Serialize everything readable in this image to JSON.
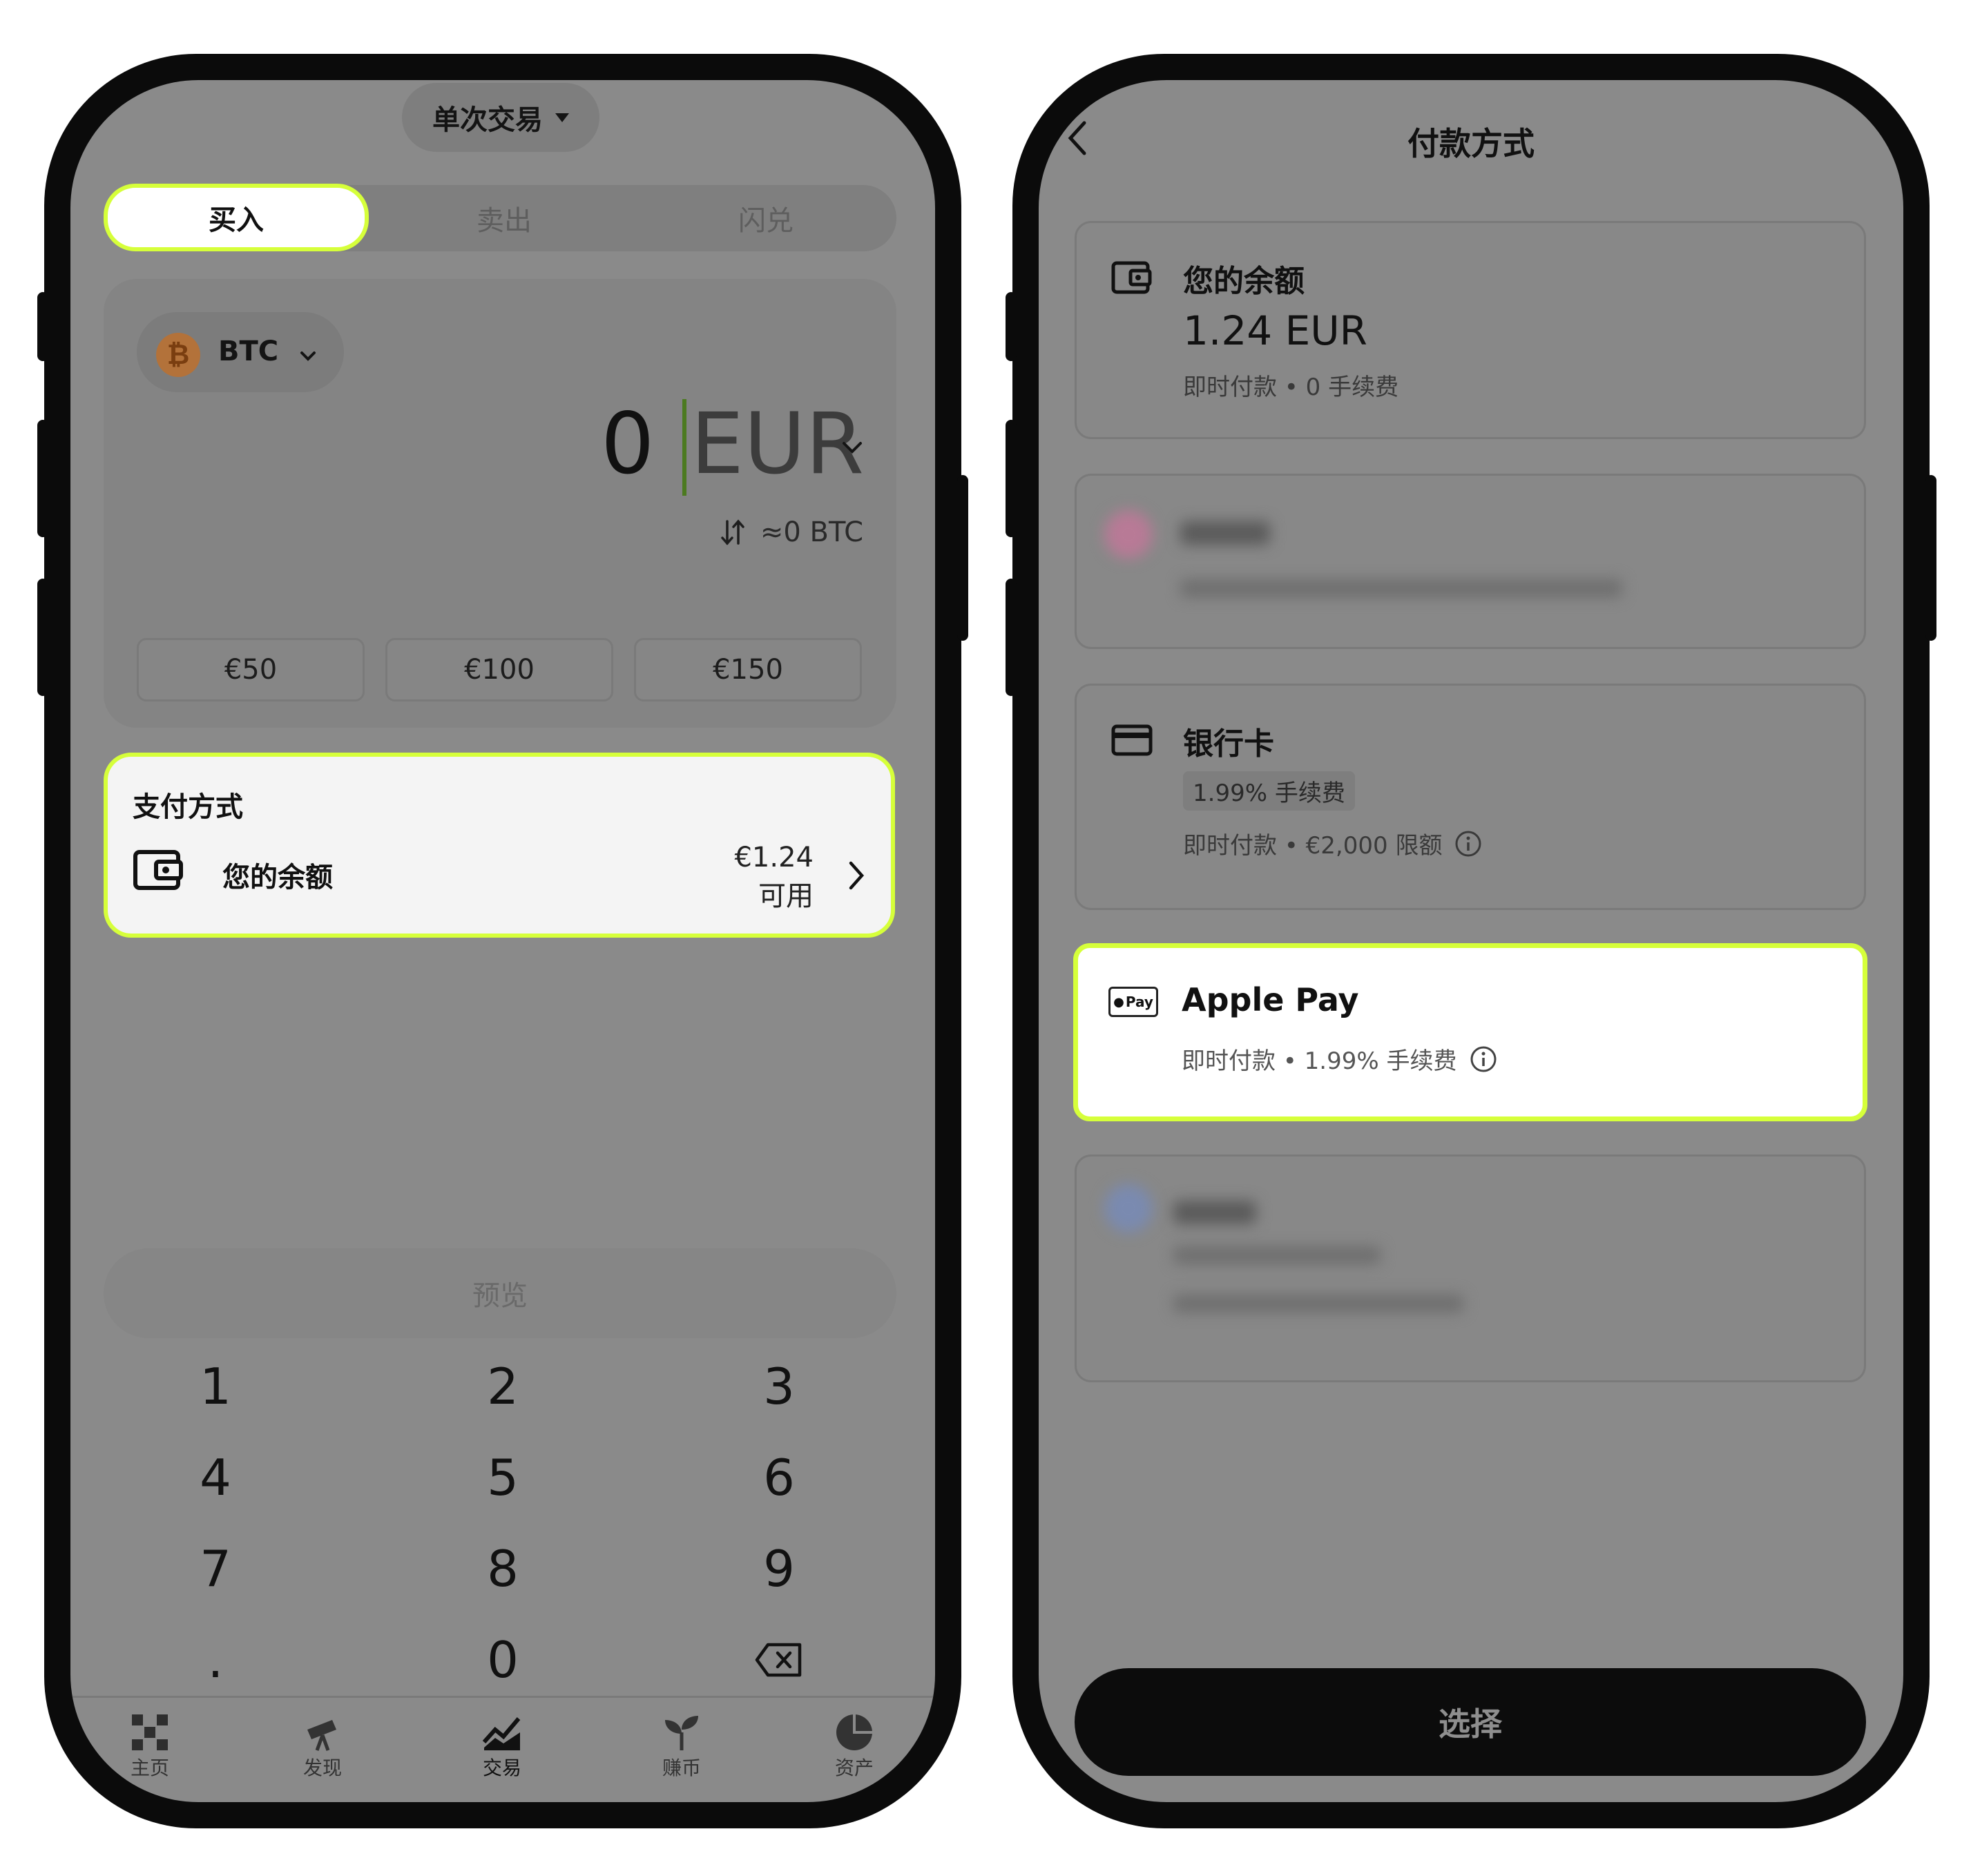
{
  "left": {
    "mode": "单次交易",
    "tabs": [
      "买入",
      "卖出",
      "闪兑"
    ],
    "coin": "BTC",
    "amount": "0",
    "currency": "EUR",
    "converted": "≈0 BTC",
    "presets": [
      "€50",
      "€100",
      "€150"
    ],
    "payment": {
      "title": "支付方式",
      "method": "您的余额",
      "balance": "€1.24",
      "available": "可用"
    },
    "preview": "预览",
    "keypad": [
      "1",
      "2",
      "3",
      "4",
      "5",
      "6",
      "7",
      "8",
      "9",
      ".",
      "0"
    ],
    "nav": [
      "主页",
      "发现",
      "交易",
      "赚币",
      "资产"
    ]
  },
  "right": {
    "title": "付款方式",
    "balance": {
      "title": "您的余额",
      "amount": "1.24 EUR",
      "sub": "即时付款 • 0 手续费"
    },
    "bank": {
      "title": "银行卡",
      "fee_badge": "1.99% 手续费",
      "sub": "即时付款 • €2,000 限额"
    },
    "applepay": {
      "title": "Apple Pay",
      "sub": "即时付款 • 1.99% 手续费",
      "logo": "Pay"
    },
    "select": "选择"
  },
  "colors": {
    "highlight": "#d6ff3a",
    "overlay": "#8a8a8a",
    "frame": "#0b0b0b"
  }
}
